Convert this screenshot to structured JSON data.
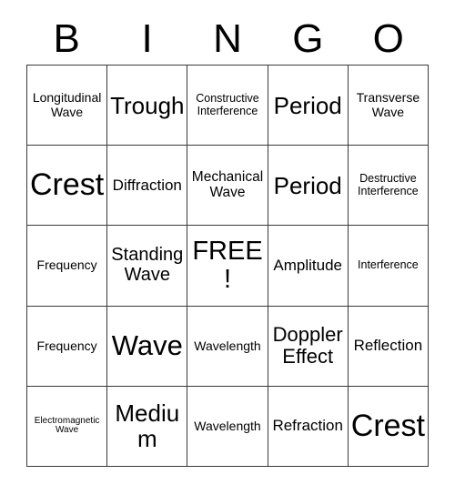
{
  "card": {
    "title": "BINGO",
    "header_letters": [
      "B",
      "I",
      "N",
      "G",
      "O"
    ],
    "free_space_label": "FREE!",
    "grid_size": "5x5",
    "colors": {
      "background": "#ffffff",
      "text": "#000000",
      "border": "#3a3a3a"
    },
    "cells": [
      {
        "label": "Longitudinal Wave",
        "size": "fs-s",
        "free": false
      },
      {
        "label": "Trough",
        "size": "fs-xxl",
        "free": false
      },
      {
        "label": "Constructive Interference",
        "size": "fs-xs",
        "free": false
      },
      {
        "label": "Period",
        "size": "fs-xxl",
        "free": false
      },
      {
        "label": "Transverse Wave",
        "size": "fs-s",
        "free": false
      },
      {
        "label": "Crest",
        "size": "fs-5xl",
        "free": false
      },
      {
        "label": "Diffraction",
        "size": "fs-ml",
        "free": false
      },
      {
        "label": "Mechanical Wave",
        "size": "fs-m",
        "free": false
      },
      {
        "label": "Period",
        "size": "fs-xxl",
        "free": false
      },
      {
        "label": "Destructive Interference",
        "size": "fs-xs",
        "free": false
      },
      {
        "label": "Frequency",
        "size": "fs-s",
        "free": false
      },
      {
        "label": "Standing Wave",
        "size": "fs-l",
        "free": false
      },
      {
        "label": "FREE!",
        "size": "fs-3xl",
        "free": true
      },
      {
        "label": "Amplitude",
        "size": "fs-ml",
        "free": false
      },
      {
        "label": "Interference",
        "size": "fs-xs",
        "free": false
      },
      {
        "label": "Frequency",
        "size": "fs-s",
        "free": false
      },
      {
        "label": "Wave",
        "size": "fs-4xl",
        "free": false
      },
      {
        "label": "Wavelength",
        "size": "fs-s",
        "free": false
      },
      {
        "label": "Doppler Effect",
        "size": "fs-xl",
        "free": false
      },
      {
        "label": "Reflection",
        "size": "fs-ml",
        "free": false
      },
      {
        "label": "Electromagnetic Wave",
        "size": "fs-xxs",
        "free": false
      },
      {
        "label": "Medium",
        "size": "fs-xxl",
        "free": false
      },
      {
        "label": "Wavelength",
        "size": "fs-s",
        "free": false
      },
      {
        "label": "Refraction",
        "size": "fs-ml",
        "free": false
      },
      {
        "label": "Crest",
        "size": "fs-5xl",
        "free": false
      }
    ]
  }
}
